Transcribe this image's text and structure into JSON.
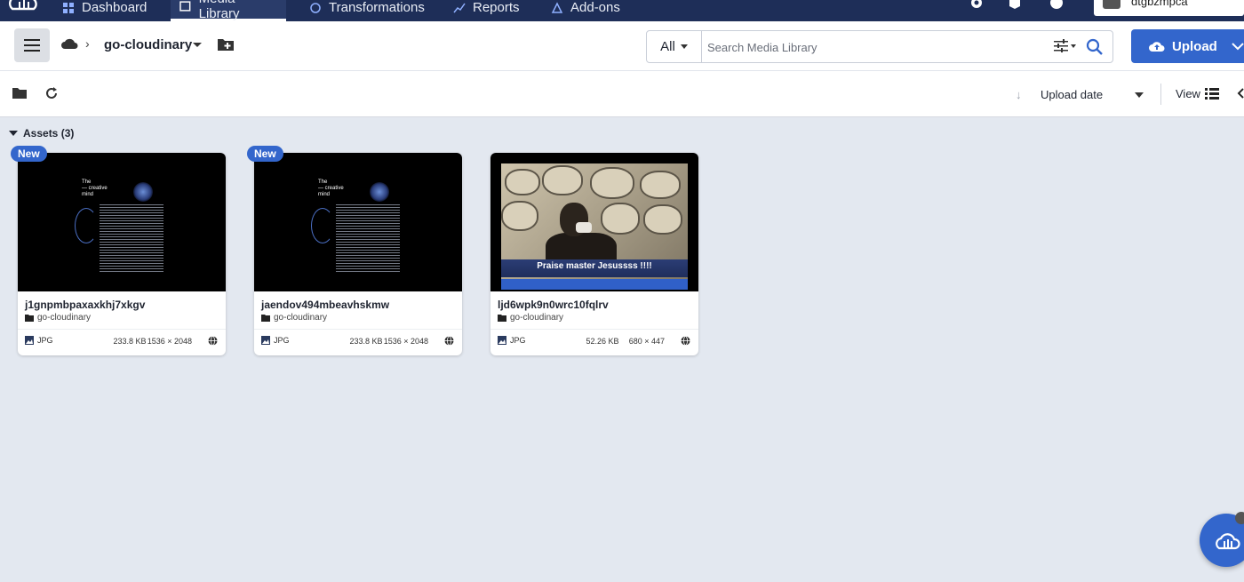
{
  "nav": {
    "items": [
      {
        "label": "Dashboard",
        "icon": "dashboard-icon",
        "active": false
      },
      {
        "label": "Media Library",
        "icon": "media-library-icon",
        "active": true
      },
      {
        "label": "Transformations",
        "icon": "transformations-icon",
        "active": false
      },
      {
        "label": "Reports",
        "icon": "reports-icon",
        "active": false
      },
      {
        "label": "Add-ons",
        "icon": "add-ons-icon",
        "active": false
      }
    ],
    "account_name": "dtgbzmpca"
  },
  "header": {
    "folder_name": "go-cloudinary",
    "search_type": "All",
    "search_placeholder": "Search Media Library",
    "upload_label": "Upload"
  },
  "toolbar": {
    "sort_label": "Upload date",
    "view_label": "View"
  },
  "assets": {
    "title": "Assets (3)",
    "items": [
      {
        "name": "j1gnpmbpaxaxkhj7xkgv",
        "folder": "go-cloudinary",
        "badge": "New",
        "type": "JPG",
        "size": "233.8 KB",
        "dimensions": "1536 × 2048",
        "thumb_title": "The\n— creative\nmind"
      },
      {
        "name": "jaendov494mbeavhskmw",
        "folder": "go-cloudinary",
        "badge": "New",
        "type": "JPG",
        "size": "233.8 KB",
        "dimensions": "1536 × 2048",
        "thumb_title": "The\n— creative\nmind"
      },
      {
        "name": "ljd6wpk9n0wrc10fqlrv",
        "folder": "go-cloudinary",
        "badge": "",
        "type": "JPG",
        "size": "52.26 KB",
        "dimensions": "680 × 447",
        "caption": "Praise master Jesussss !!!!"
      }
    ]
  },
  "colors": {
    "nav_bg": "#1e2e58",
    "accent": "#3366cc",
    "page_bg": "#e3e8f0"
  }
}
